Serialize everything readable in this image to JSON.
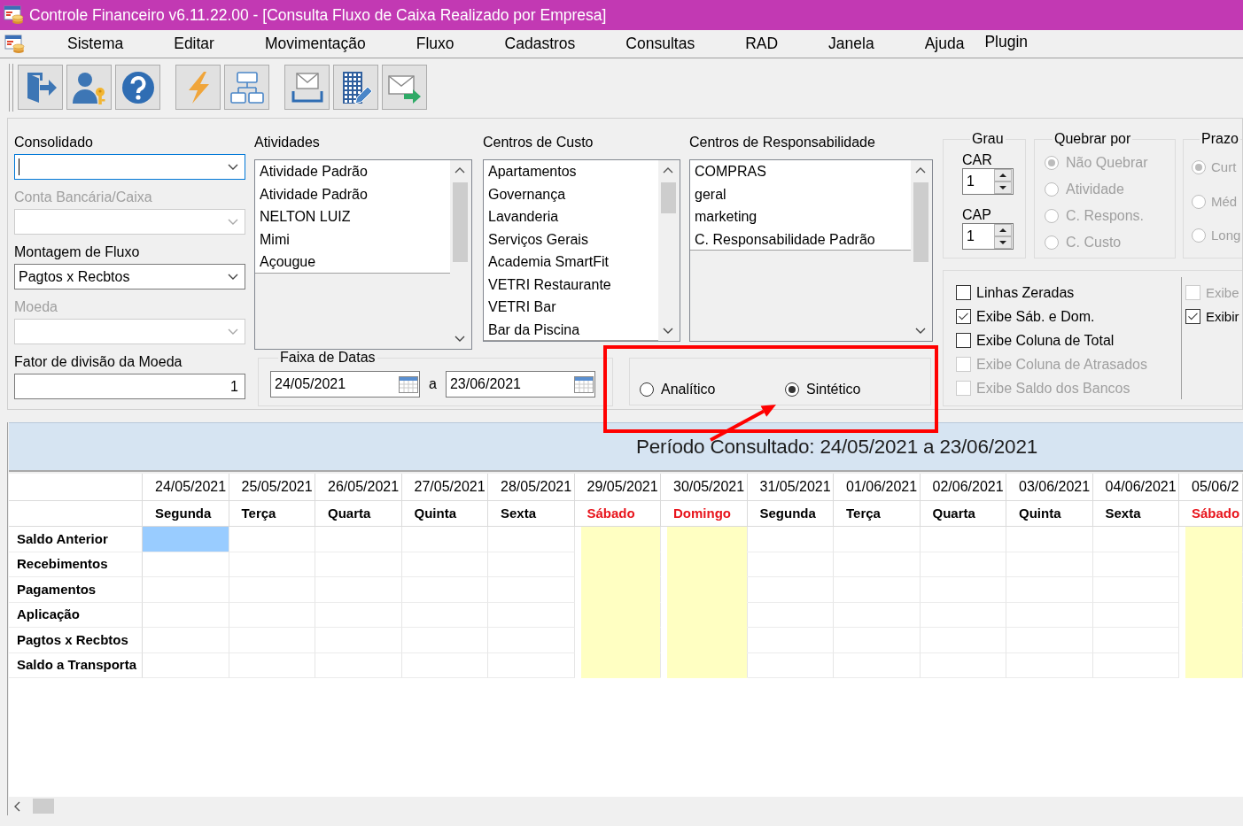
{
  "window": {
    "title": "Controle Financeiro v6.11.22.00 - [Consulta Fluxo de Caixa Realizado por Empresa]"
  },
  "menu": [
    "Sistema",
    "Editar",
    "Movimentação",
    "Fluxo",
    "Cadastros",
    "Consultas",
    "RAD",
    "Janela",
    "Ajuda",
    "Plugin"
  ],
  "fields": [
    {
      "kind": "combo",
      "label": "Consolidado",
      "focused": true,
      "disabled": false
    },
    {
      "kind": "combo",
      "label": "Conta Bancária/Caixa",
      "focused": false,
      "disabled": true
    },
    {
      "kind": "combo",
      "label": "Montagem de Fluxo",
      "value": "Pagtos x Recbtos",
      "focused": false,
      "disabled": false
    },
    {
      "kind": "combo",
      "label": "Moeda",
      "focused": false,
      "disabled": true
    },
    {
      "kind": "number",
      "label": "Fator de divisão da Moeda",
      "value": "1",
      "focused": false,
      "disabled": false
    }
  ],
  "lists": [
    {
      "label": "Atividades",
      "items": [
        "Atividade Padrão",
        "Atividade Padrão",
        "NELTON LUIZ",
        "Mimi",
        "Açougue"
      ]
    },
    {
      "label": "Centros de Custo",
      "items": [
        "Apartamentos",
        "Governança",
        "Lavanderia",
        "Serviços Gerais",
        "Academia SmartFit",
        "VETRI Restaurante",
        "VETRI Bar",
        "Bar da Piscina"
      ]
    },
    {
      "label": "Centros de Responsabilidade",
      "items": [
        "COMPRAS",
        "geral",
        "marketing",
        "C. Responsabilidade Padrão"
      ]
    }
  ],
  "date_range": {
    "label": "Faixa de Datas",
    "from": "24/05/2021",
    "separator": "a",
    "to": "23/06/2021"
  },
  "mode": [
    {
      "label": "Analítico",
      "selected": false
    },
    {
      "label": "Sintético",
      "selected": true
    }
  ],
  "grau": {
    "label": "Grau",
    "spinners": [
      {
        "label": "CAR",
        "value": "1"
      },
      {
        "label": "CAP",
        "value": "1"
      }
    ]
  },
  "quebrar_por": {
    "label": "Quebrar por",
    "disabled": true,
    "options": [
      {
        "label": "Não Quebrar",
        "selected": true
      },
      {
        "label": "Atividade",
        "selected": false
      },
      {
        "label": "C. Respons.",
        "selected": false
      },
      {
        "label": "C. Custo",
        "selected": false
      }
    ]
  },
  "prazo": {
    "label": "Prazo",
    "disabled": true,
    "options": [
      {
        "label": "Curt",
        "selected": true
      },
      {
        "label": "Méd",
        "selected": false
      },
      {
        "label": "Long",
        "selected": false
      }
    ]
  },
  "display_options": [
    {
      "items": [
        {
          "label": "Linhas Zeradas",
          "checked": false,
          "disabled": false
        },
        {
          "label": "Exibe Sáb. e Dom.",
          "checked": true,
          "disabled": false
        },
        {
          "label": "Exibe Coluna de Total",
          "checked": false,
          "disabled": false
        },
        {
          "label": "Exibe Coluna de Atrasados",
          "checked": false,
          "disabled": true
        },
        {
          "label": "Exibe Saldo dos Bancos",
          "checked": false,
          "disabled": true
        }
      ]
    },
    {
      "items": [
        {
          "label": "Exibe",
          "checked": false,
          "disabled": true
        },
        {
          "label": "Exibir",
          "checked": true,
          "disabled": false
        }
      ]
    }
  ],
  "period": {
    "text": "Período Consultado: 24/05/2021 a 23/06/2021"
  },
  "grid": {
    "columns": [
      {
        "date": "24/05/2021",
        "weekday": "Segunda",
        "weekend": false
      },
      {
        "date": "25/05/2021",
        "weekday": "Terça",
        "weekend": false
      },
      {
        "date": "26/05/2021",
        "weekday": "Quarta",
        "weekend": false
      },
      {
        "date": "27/05/2021",
        "weekday": "Quinta",
        "weekend": false
      },
      {
        "date": "28/05/2021",
        "weekday": "Sexta",
        "weekend": false
      },
      {
        "date": "29/05/2021",
        "weekday": "Sábado",
        "weekend": true
      },
      {
        "date": "30/05/2021",
        "weekday": "Domingo",
        "weekend": true
      },
      {
        "date": "31/05/2021",
        "weekday": "Segunda",
        "weekend": false
      },
      {
        "date": "01/06/2021",
        "weekday": "Terça",
        "weekend": false
      },
      {
        "date": "02/06/2021",
        "weekday": "Quarta",
        "weekend": false
      },
      {
        "date": "03/06/2021",
        "weekday": "Quinta",
        "weekend": false
      },
      {
        "date": "04/06/2021",
        "weekday": "Sexta",
        "weekend": false
      },
      {
        "date": "05/06/2",
        "weekday": "Sábado",
        "weekend": true
      }
    ],
    "rows": [
      {
        "label": "Saldo Anterior",
        "cells": [
          {
            "selected": true
          },
          {
            "selected": false
          },
          {
            "selected": false
          },
          {
            "selected": false
          },
          {
            "selected": false
          },
          {
            "selected": false
          },
          {
            "selected": false
          },
          {
            "selected": false
          },
          {
            "selected": false
          },
          {
            "selected": false
          },
          {
            "selected": false
          },
          {
            "selected": false
          },
          {
            "selected": false
          }
        ]
      },
      {
        "label": "Recebimentos",
        "cells": [
          {
            "selected": false
          },
          {
            "selected": false
          },
          {
            "selected": false
          },
          {
            "selected": false
          },
          {
            "selected": false
          },
          {
            "selected": false
          },
          {
            "selected": false
          },
          {
            "selected": false
          },
          {
            "selected": false
          },
          {
            "selected": false
          },
          {
            "selected": false
          },
          {
            "selected": false
          },
          {
            "selected": false
          }
        ]
      },
      {
        "label": "Pagamentos",
        "cells": [
          {
            "selected": false
          },
          {
            "selected": false
          },
          {
            "selected": false
          },
          {
            "selected": false
          },
          {
            "selected": false
          },
          {
            "selected": false
          },
          {
            "selected": false
          },
          {
            "selected": false
          },
          {
            "selected": false
          },
          {
            "selected": false
          },
          {
            "selected": false
          },
          {
            "selected": false
          },
          {
            "selected": false
          }
        ]
      },
      {
        "label": "Aplicação",
        "cells": [
          {
            "selected": false
          },
          {
            "selected": false
          },
          {
            "selected": false
          },
          {
            "selected": false
          },
          {
            "selected": false
          },
          {
            "selected": false
          },
          {
            "selected": false
          },
          {
            "selected": false
          },
          {
            "selected": false
          },
          {
            "selected": false
          },
          {
            "selected": false
          },
          {
            "selected": false
          },
          {
            "selected": false
          }
        ]
      },
      {
        "label": "Pagtos x Recbtos",
        "cells": [
          {
            "selected": false
          },
          {
            "selected": false
          },
          {
            "selected": false
          },
          {
            "selected": false
          },
          {
            "selected": false
          },
          {
            "selected": false
          },
          {
            "selected": false
          },
          {
            "selected": false
          },
          {
            "selected": false
          },
          {
            "selected": false
          },
          {
            "selected": false
          },
          {
            "selected": false
          },
          {
            "selected": false
          }
        ]
      },
      {
        "label": "Saldo a Transporta",
        "cells": [
          {
            "selected": false
          },
          {
            "selected": false
          },
          {
            "selected": false
          },
          {
            "selected": false
          },
          {
            "selected": false
          },
          {
            "selected": false
          },
          {
            "selected": false
          },
          {
            "selected": false
          },
          {
            "selected": false
          },
          {
            "selected": false
          },
          {
            "selected": false
          },
          {
            "selected": false
          },
          {
            "selected": false
          }
        ]
      }
    ]
  }
}
